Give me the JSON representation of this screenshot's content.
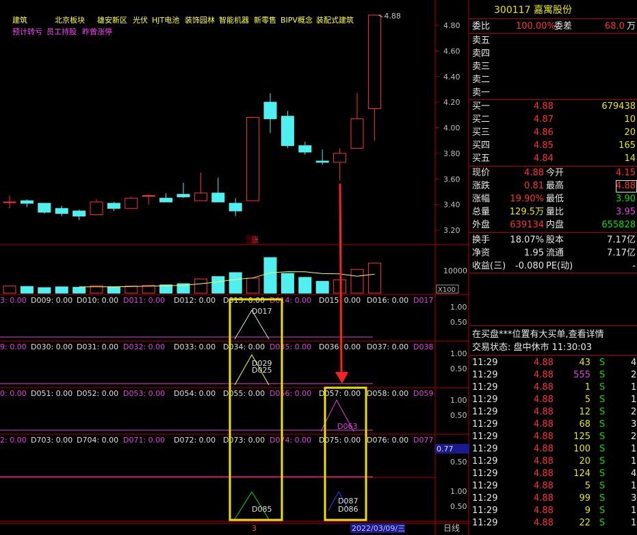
{
  "stock": {
    "code": "300117",
    "name": "嘉寓股份"
  },
  "header_tags": {
    "line1": [
      "建筑",
      "北京板块",
      "雄安新区",
      "光伏",
      "HJT电池",
      "装饰园林",
      "智能机器",
      "新零售",
      "BIPV概念",
      "装配式建筑"
    ],
    "line2": [
      "预计转亏",
      "员工持股",
      "昨曾涨停"
    ]
  },
  "weibi": {
    "label1": "委比",
    "value1": "100.00%",
    "label2": "委差",
    "value2": "68.0",
    "unit2": "万"
  },
  "sell_orders": [
    "卖五",
    "卖四",
    "卖三",
    "卖二",
    "卖一"
  ],
  "buy_orders": [
    {
      "label": "买一",
      "price": "4.88",
      "volume": "679438"
    },
    {
      "label": "买二",
      "price": "4.87",
      "volume": "10"
    },
    {
      "label": "买三",
      "price": "4.86",
      "volume": "20"
    },
    {
      "label": "买四",
      "price": "4.85",
      "volume": "165"
    },
    {
      "label": "买五",
      "price": "4.84",
      "volume": "14"
    }
  ],
  "quote": [
    {
      "l1": "现价",
      "v1": "4.88",
      "l2": "今开",
      "v2": "4.15"
    },
    {
      "l1": "涨跌",
      "v1": "0.81",
      "l2": "最高",
      "v2": "4.88"
    },
    {
      "l1": "涨幅",
      "v1": "19.90%",
      "l2": "最低",
      "v2": "3.90"
    },
    {
      "l1": "总量",
      "v1": "129.5万",
      "l2": "量比",
      "v2": "3.95"
    },
    {
      "l1": "外盘",
      "v1": "639134",
      "l2": "内盘",
      "v2": "655828"
    }
  ],
  "stats": [
    {
      "l1": "换手",
      "v1": "18.07%",
      "l2": "股本",
      "v2": "7.17亿"
    },
    {
      "l1": "净资",
      "v1": "1.95",
      "l2": "流通",
      "v2": "7.17亿"
    },
    {
      "l1": "收益(三)",
      "v1": "-0.080",
      "l2": "PE(动)",
      "v2": "-"
    }
  ],
  "notice": "在买盘***位置有大买单,查看详情",
  "trade_status": "交易状态: 盘中休市 11:30:03",
  "ticks": [
    {
      "time": "11:29",
      "price": "4.88",
      "vol": "43",
      "side": "S",
      "n": "4"
    },
    {
      "time": "11:29",
      "price": "4.88",
      "vol": "555",
      "side": "S",
      "n": "2"
    },
    {
      "time": "11:29",
      "price": "4.88",
      "vol": "1",
      "side": "S",
      "n": "1"
    },
    {
      "time": "11:29",
      "price": "4.88",
      "vol": "5",
      "side": "S",
      "n": "1"
    },
    {
      "time": "11:29",
      "price": "4.88",
      "vol": "12",
      "side": "S",
      "n": "2"
    },
    {
      "time": "11:29",
      "price": "4.88",
      "vol": "68",
      "side": "S",
      "n": "3"
    },
    {
      "time": "11:29",
      "price": "4.88",
      "vol": "125",
      "side": "S",
      "n": "2"
    },
    {
      "time": "11:29",
      "price": "4.88",
      "vol": "100",
      "side": "S",
      "n": "1"
    },
    {
      "time": "11:29",
      "price": "4.88",
      "vol": "20",
      "side": "S",
      "n": "1"
    },
    {
      "time": "11:29",
      "price": "4.88",
      "vol": "124",
      "side": "S",
      "n": "4"
    },
    {
      "time": "11:29",
      "price": "4.88",
      "vol": "5",
      "side": "S",
      "n": "1"
    },
    {
      "time": "11:29",
      "price": "4.88",
      "vol": "99",
      "side": "S",
      "n": "3"
    },
    {
      "time": "11:29",
      "price": "4.88",
      "vol": "9",
      "side": "S",
      "n": "1"
    },
    {
      "time": "11:29",
      "price": "4.88",
      "vol": "22",
      "side": "S",
      "n": "1"
    }
  ],
  "chart": {
    "price_axis": [
      "4.80",
      "4.60",
      "4.40",
      "4.20",
      "4.00",
      "3.80",
      "3.60",
      "3.40",
      "3.20"
    ],
    "high_label": "4.88",
    "limit_up_marker": "涨",
    "volume_axis": "10000",
    "volume_unit": "X100",
    "volume_ma_color": "#ffff60",
    "candles": [
      {
        "o": 3.42,
        "h": 3.47,
        "l": 3.37,
        "c": 3.42
      },
      {
        "o": 3.43,
        "h": 3.44,
        "l": 3.38,
        "c": 3.41
      },
      {
        "o": 3.41,
        "h": 3.41,
        "l": 3.33,
        "c": 3.34
      },
      {
        "o": 3.37,
        "h": 3.39,
        "l": 3.31,
        "c": 3.33
      },
      {
        "o": 3.35,
        "h": 3.36,
        "l": 3.28,
        "c": 3.31
      },
      {
        "o": 3.32,
        "h": 3.44,
        "l": 3.32,
        "c": 3.42
      },
      {
        "o": 3.41,
        "h": 3.42,
        "l": 3.35,
        "c": 3.37
      },
      {
        "o": 3.37,
        "h": 3.46,
        "l": 3.37,
        "c": 3.45
      },
      {
        "o": 3.47,
        "h": 3.48,
        "l": 3.4,
        "c": 3.47
      },
      {
        "o": 3.45,
        "h": 3.49,
        "l": 3.42,
        "c": 3.42
      },
      {
        "o": 3.48,
        "h": 3.57,
        "l": 3.45,
        "c": 3.46
      },
      {
        "o": 3.43,
        "h": 3.65,
        "l": 3.43,
        "c": 3.49
      },
      {
        "o": 3.49,
        "h": 3.61,
        "l": 3.42,
        "c": 3.42
      },
      {
        "o": 3.41,
        "h": 3.45,
        "l": 3.31,
        "c": 3.35
      },
      {
        "o": 3.43,
        "h": 4.08,
        "l": 3.43,
        "c": 4.08
      },
      {
        "o": 4.2,
        "h": 4.27,
        "l": 3.96,
        "c": 4.07
      },
      {
        "o": 4.09,
        "h": 4.13,
        "l": 3.84,
        "c": 3.86
      },
      {
        "o": 3.86,
        "h": 3.89,
        "l": 3.79,
        "c": 3.81
      },
      {
        "o": 3.74,
        "h": 3.83,
        "l": 3.71,
        "c": 3.73
      },
      {
        "o": 3.73,
        "h": 3.84,
        "l": 3.59,
        "c": 3.8
      },
      {
        "o": 3.84,
        "h": 4.27,
        "l": 3.84,
        "c": 4.07
      },
      {
        "o": 4.15,
        "h": 4.88,
        "l": 3.9,
        "c": 4.88
      }
    ],
    "volumes": [
      900,
      850,
      700,
      800,
      750,
      950,
      800,
      900,
      1000,
      1050,
      1200,
      1800,
      2100,
      2600,
      1900,
      4500,
      2500,
      2000,
      1500,
      1700,
      3000,
      3800
    ],
    "signal_rows": [
      {
        "labels": [
          "3: 0.00",
          "D009: 0.00",
          "D010: 0.00",
          "D011: 0.00",
          "D012: 0.00",
          "D013: 0.00",
          "D014: 0.00",
          "D015: 0.00",
          "D016: 0.00",
          "D017"
        ],
        "axis": [
          "1.00",
          "0.50"
        ]
      },
      {
        "labels": [
          "9: 0.00",
          "D030: 0.00",
          "D031: 0.00",
          "D032: 0.00",
          "D033: 0.00",
          "D034: 0.00",
          "D035: 0.00",
          "D036: 0.00",
          "D037: 0.00",
          "D038"
        ],
        "axis": [
          "1.00",
          "0.50"
        ]
      },
      {
        "labels": [
          "0: 0.00",
          "D051: 0.00",
          "D052: 0.00",
          "D053: 0.00",
          "D054: 0.00",
          "D055: 0.00",
          "D056: 0.00",
          "D057: 0.00",
          "D058: 0.00",
          "D059"
        ],
        "axis": [
          "1.00",
          "0.50"
        ]
      },
      {
        "labels": [
          "2: 0.00",
          "D703: 0.00",
          "D704: 0.00",
          "D071: 0.00",
          "D072: 0.00",
          "D073: 0.00",
          "D074: 0.00",
          "D075: 0.00",
          "D076: 0.00",
          "D077"
        ],
        "axis": [
          "0.77",
          "0.50"
        ]
      },
      {
        "labels": [],
        "axis": [
          "1.00",
          "0.50"
        ]
      }
    ],
    "triangle_labels": {
      "a": "D017",
      "b1": "D029",
      "b2": "D025",
      "c": "D063",
      "d": "D085",
      "e1": "D087",
      "e2": "D086"
    },
    "bottom_bar": {
      "marker": "3",
      "date": "2022/03/09/三",
      "period": "日线"
    }
  }
}
